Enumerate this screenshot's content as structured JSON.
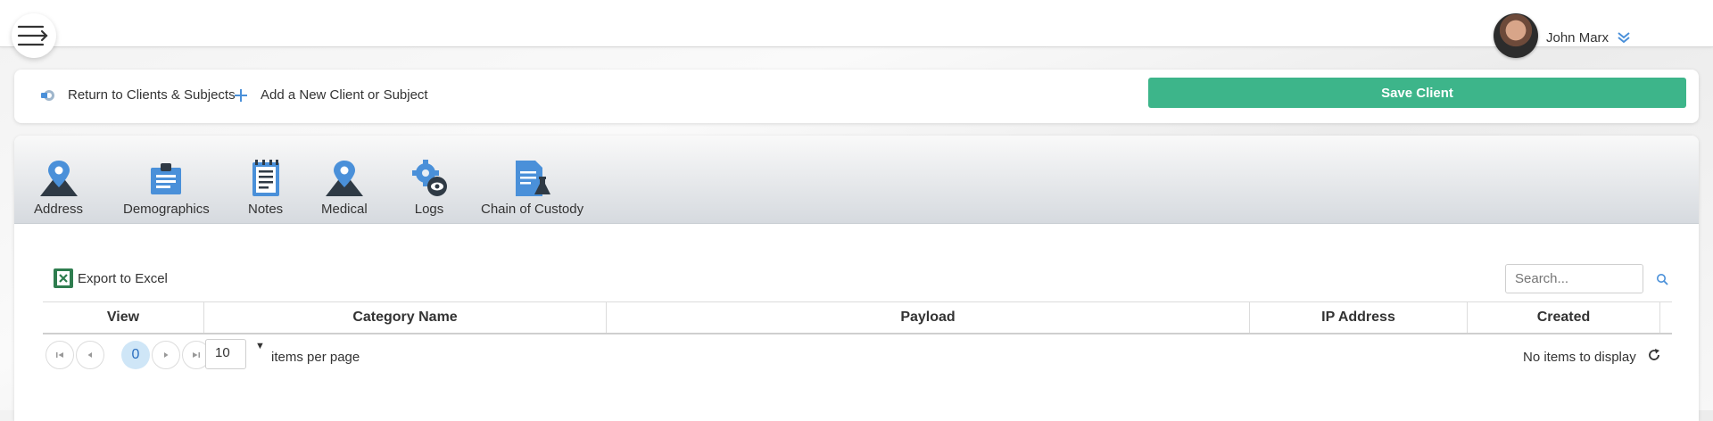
{
  "header": {
    "menu_icon": "menu-icon",
    "user_name": "John Marx",
    "user_menu_icon": "double-chevron-down-icon"
  },
  "actions": {
    "return_label": "Return to Clients & Subjects",
    "add_label": "Add a New Client or Subject",
    "save_label": "Save Client",
    "save_color": "#3db58a"
  },
  "tabs": [
    {
      "label": "Address",
      "icon": "map-pin-icon"
    },
    {
      "label": "Demographics",
      "icon": "id-card-icon"
    },
    {
      "label": "Notes",
      "icon": "notepad-icon"
    },
    {
      "label": "Medical",
      "icon": "map-pin-icon"
    },
    {
      "label": "Logs",
      "icon": "gear-eye-icon"
    },
    {
      "label": "Chain of Custody",
      "icon": "document-flask-icon"
    }
  ],
  "toolbar": {
    "export_label": "Export to Excel",
    "search_placeholder": "Search..."
  },
  "grid": {
    "columns": [
      "View",
      "Category Name",
      "Payload",
      "IP Address",
      "Created"
    ]
  },
  "pager": {
    "current_page": "0",
    "page_size": "10",
    "items_per_page_label": "items per page",
    "status": "No items to display"
  },
  "colors": {
    "accent_blue": "#4a90d9",
    "icon_dark": "#2f3a45"
  }
}
